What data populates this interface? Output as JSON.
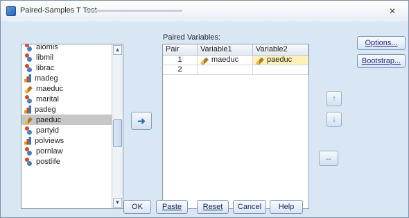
{
  "window": {
    "title": "Paired-Samples T Test",
    "close_glyph": "✕"
  },
  "variables": [
    {
      "label": "aiomis",
      "icon": "nominal"
    },
    {
      "label": "libmil",
      "icon": "nominal"
    },
    {
      "label": "librac",
      "icon": "nominal"
    },
    {
      "label": "madeg",
      "icon": "ordinal"
    },
    {
      "label": "maeduc",
      "icon": "scale"
    },
    {
      "label": "marital",
      "icon": "nominal"
    },
    {
      "label": "padeg",
      "icon": "ordinal"
    },
    {
      "label": "paeduc",
      "icon": "scale"
    },
    {
      "label": "partyid",
      "icon": "nominal"
    },
    {
      "label": "polviews",
      "icon": "ordinal"
    },
    {
      "label": "pornlaw",
      "icon": "nominal"
    },
    {
      "label": "postlife",
      "icon": "nominal"
    }
  ],
  "selected_variable": "paeduc",
  "paired": {
    "label": "Paired Variables:",
    "headers": [
      "Pair",
      "Variable1",
      "Variable2"
    ],
    "rows": [
      {
        "pair": "1",
        "var1": "maeduc",
        "var2": "paeduc"
      },
      {
        "pair": "2",
        "var1": "",
        "var2": ""
      }
    ]
  },
  "right_buttons": {
    "options": "Options...",
    "bootstrap": "Bootstrap..."
  },
  "bottom_buttons": {
    "ok": "OK",
    "paste": "Paste",
    "reset": "Reset",
    "cancel": "Cancel",
    "help": "Help"
  },
  "icons": {
    "move": "arrow-right-icon",
    "up": "arrow-up-icon",
    "down": "arrow-down-icon",
    "swap": "swap-icon"
  },
  "colors": {
    "dialog_bg": "#d9e6f4",
    "selection": "#c7c7c7",
    "highlight_cell": "#fff1b8"
  }
}
